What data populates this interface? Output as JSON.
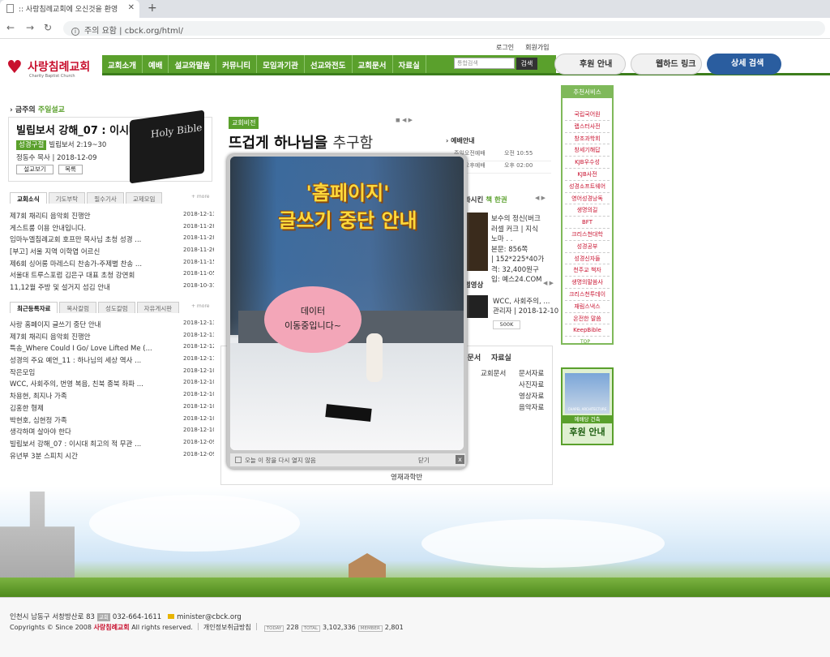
{
  "browser": {
    "tab_title": ":: 사랑침례교회에 오신것을 환영",
    "url_warning": "주의 요함",
    "url": "cbck.org/html/"
  },
  "header": {
    "login": "로그인",
    "join": "회원가입",
    "logo_name": "사랑침례교회",
    "logo_sub": "Charity Baptist Church",
    "menu": [
      "교회소개",
      "예배",
      "설교와말씀",
      "커뮤니티",
      "모임과기관",
      "선교와전도",
      "교회문서",
      "자료실"
    ],
    "search_placeholder": "통합검색",
    "search_button": "검색",
    "btn_donate": "후원 안내",
    "btn_webhard": "웹하드 링크",
    "btn_search": "상세 검색"
  },
  "sermon": {
    "label_prefix": "금주의",
    "label_main": "주일설교",
    "title": "빌립보서 강해_07 : 이시대",
    "verse_tag": "성경구절",
    "verse": "빌립보서 2:19~30",
    "pastor": "정동수 목사",
    "date": "2018-12-09",
    "btn_view": "설교보기",
    "btn_list": "목록",
    "bible": "Holy Bible"
  },
  "news": {
    "tabs": [
      "교회소식",
      "기도부탁",
      "필수기사",
      "교제모임"
    ],
    "more": "+ more",
    "items": [
      {
        "t": "제7회 채리티 음악회 진행안",
        "d": "2018-12-13"
      },
      {
        "t": "게스트룸 이용 안내입니다.",
        "d": "2018-11-28"
      },
      {
        "t": "임마누엘침례교회 호프만 목사님 초청 성경 ...",
        "d": "2018-11-28"
      },
      {
        "t": "[부고] 서울 지역 이학엽 어르신",
        "d": "2018-11-26"
      },
      {
        "t": "제6회 싱어롱 마레스티 찬송가-주제별 찬송 ...",
        "d": "2018-11-15"
      },
      {
        "t": "서울대 트루스포럼 김은구 대표 초청 강연회",
        "d": "2018-11-05"
      },
      {
        "t": "11,12월 주방 및 설거지 섬김 안내",
        "d": "2018-10-31"
      }
    ]
  },
  "recent": {
    "tabs": [
      "최근등록자료",
      "목사칼럼",
      "성도칼럼",
      "자유게시판"
    ],
    "more": "+ more",
    "items": [
      {
        "t": "사랑 홈페이지 글쓰기 중단 안내",
        "d": "2018-12-13"
      },
      {
        "t": "제7회 채리티 음악회 진행안",
        "d": "2018-12-13"
      },
      {
        "t": "특송_Where Could I Go/ Love Lifted Me (...",
        "d": "2018-12-12"
      },
      {
        "t": "성경의 주요 예언_11 : 하나님의 세상 역사 ...",
        "d": "2018-12-11"
      },
      {
        "t": "작은모임",
        "d": "2018-12-10"
      },
      {
        "t": "WCC, 사회주의, 번영 복음, 친북 종북 좌파 ...",
        "d": "2018-12-10"
      },
      {
        "t": "차용현, 최지나 가족",
        "d": "2018-12-10"
      },
      {
        "t": "김홍한 형제",
        "d": "2018-12-10"
      },
      {
        "t": "박현호, 심현정 가족",
        "d": "2018-12-10"
      },
      {
        "t": "생각하며 살아야 한다",
        "d": "2018-12-10"
      },
      {
        "t": "빌립보서 강해_07 : 이시대 최고의 적 무관 ...",
        "d": "2018-12-09"
      },
      {
        "t": "유년부 3분 스피치 시간",
        "d": "2018-12-09"
      }
    ]
  },
  "vision": {
    "tag": "교회비전",
    "title_bold": "뜨겁게 하나님을",
    "title_rest": "추구함"
  },
  "worship": {
    "title": "예배안내",
    "rows": [
      {
        "name": "주일오전예배",
        "time": "오전 10:55"
      },
      {
        "name": "주일오후예배",
        "time": "오후 02:00"
      }
    ]
  },
  "book": {
    "title_prefix": "변화시킨",
    "title_main": "책 한권",
    "lines": [
      "보수의 정신(버크",
      "러셀 커크 | 지식",
      "노마 . .",
      "본문: 856쪽",
      "| 152*225*40가",
      "격: 32,400원구",
      "입: 예스24.COM"
    ]
  },
  "video": {
    "title": "특별영상",
    "lines": [
      "WCC, 사회주의, ...",
      "관리자 | 2018-12-10"
    ],
    "btn": "500K"
  },
  "category": {
    "heads": [
      "교회문서",
      "자료실"
    ],
    "col1": [
      "교회문서"
    ],
    "col2": [
      "문서자료",
      "사진자료",
      "영상자료",
      "음악자료"
    ],
    "bottom": "영재과학반"
  },
  "popup": {
    "title1": "'홈페이지'",
    "title2": "글쓰기 중단 안내",
    "bubble1": "데이터",
    "bubble2": "이동중입니다~",
    "footer": "오늘 이 창을 다시 열지 않음",
    "close": "닫기",
    "x": "x"
  },
  "sidebar": {
    "title": "추천서비스",
    "items": [
      "국립국어원",
      "랩스터사전",
      "창조과학회",
      "창세기해답",
      "KJB우수성",
      "KJB사전",
      "성경소프트웨어",
      "영어성경낭독",
      "생명의길",
      "BFT",
      "크리스천대학",
      "성경공부",
      "성경신자들",
      "천주교 책자",
      "생명의말씀사",
      "크리스천투데이",
      "재림스낵스",
      "온전한 말씀",
      "KeepBible"
    ],
    "top": "TOP",
    "donate_small": "예배당 건축",
    "donate_big": "후원 안내",
    "chapel": "CHAPEL ARCHITECTURE"
  },
  "footer": {
    "address": "인천시 남동구 서창방산로 83",
    "tel_label": "교회",
    "tel": "032-664-1611",
    "email": "minister@cbck.org",
    "copy_prefix": "Copyrights © Since 2008",
    "copy_name": "사랑침례교회",
    "copy_suffix": "All rights reserved.",
    "privacy": "개인정보취급방침",
    "today_label": "TODAY",
    "today": "228",
    "total_label": "TOTAL",
    "total": "3,102,336",
    "member_label": "MEMBER",
    "member": "2,801"
  }
}
